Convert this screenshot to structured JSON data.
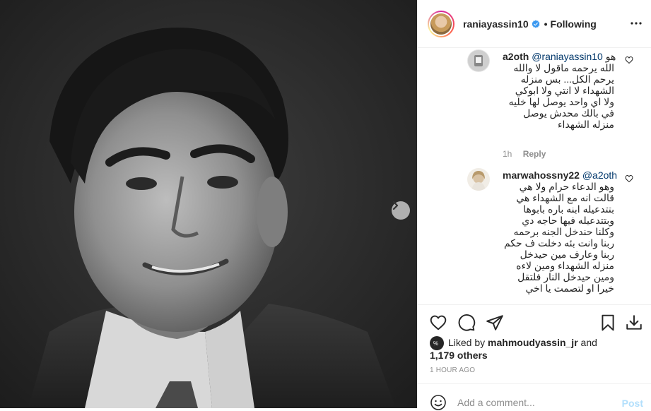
{
  "post": {
    "owner": {
      "username": "raniayassin10",
      "verified": true,
      "follow_status": "Following",
      "separator": "•"
    },
    "comments": [
      {
        "username": "a2oth",
        "mention": "@raniayassin10",
        "text_first": "هو",
        "text": "الله يرحمه ماقول لا والله\nيرحم الكل... بس منزله\nالشهداء لا انتي ولا ابوكي\nولا اي واحد يوصل لها خليه\nفي بالك محدش يوصل\nمنزله الشهداء",
        "time": "1h",
        "reply_label": "Reply"
      },
      {
        "username": "marwahossny22",
        "mention": "@a2oth",
        "text": "وهو الدعاء حرام ولا هي\nقالت انه مع الشهداء هي\nبتتدعيله ابنه باره بابوها\nوبتتدعيله فيها حاجه دي\nوكلنا حندخل الجنه برحمه\nربنا وانت بئه دخلت ف حكم\nربنا وعارف مين حيدخل\nمنزله الشهداء ومين لاءه\nومين حيدخل النار فلتقل\nخيرا او لتصمت يا اخي"
      }
    ],
    "likes": {
      "prefix": "Liked by",
      "liked_by": "mahmoudyassin_jr",
      "and": "and",
      "others": "1,179 others"
    },
    "timestamp": "1 hour ago",
    "comment_input": {
      "placeholder": "Add a comment...",
      "post_label": "Post"
    },
    "colors": {
      "verified_blue": "#3897f0",
      "link_blue": "#00376b",
      "post_disabled": "#b2dffc",
      "muted": "#8e8e8e"
    },
    "icons": [
      "verified-badge-icon",
      "more-options-icon",
      "heart-icon",
      "comment-icon",
      "share-icon",
      "bookmark-icon",
      "download-icon",
      "emoji-icon",
      "chevron-right-icon"
    ]
  }
}
